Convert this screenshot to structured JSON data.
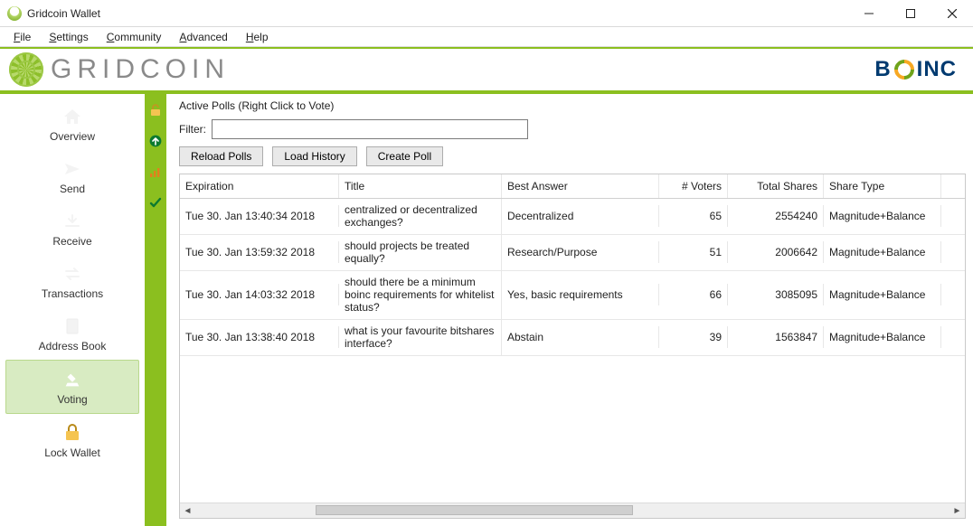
{
  "window": {
    "title": "Gridcoin Wallet"
  },
  "menu": {
    "file": "File",
    "settings": "Settings",
    "community": "Community",
    "advanced": "Advanced",
    "help": "Help"
  },
  "brand": {
    "name": "GRIDCOIN",
    "boinc_b": "B",
    "boinc_inc": "INC"
  },
  "sidebar": {
    "items": [
      {
        "key": "overview",
        "label": "Overview"
      },
      {
        "key": "send",
        "label": "Send"
      },
      {
        "key": "receive",
        "label": "Receive"
      },
      {
        "key": "transactions",
        "label": "Transactions"
      },
      {
        "key": "addressbook",
        "label": "Address Book"
      },
      {
        "key": "voting",
        "label": "Voting"
      },
      {
        "key": "lockwallet",
        "label": "Lock Wallet"
      }
    ],
    "active_key": "voting"
  },
  "statusbar": {
    "lock_icon": "lock-open-icon",
    "sync_icon": "arrow-up-circle-icon",
    "signal_icon": "signal-bars-icon",
    "check_icon": "checkmark-icon"
  },
  "main": {
    "title": "Active Polls (Right Click to Vote)",
    "filter_label": "Filter:",
    "filter_value": "",
    "buttons": {
      "reload": "Reload Polls",
      "history": "Load History",
      "create": "Create Poll"
    },
    "columns": {
      "expiration": "Expiration",
      "title": "Title",
      "best_answer": "Best Answer",
      "voters": "# Voters",
      "shares": "Total Shares",
      "share_type": "Share Type"
    },
    "rows": [
      {
        "expiration": "Tue 30. Jan 13:40:34 2018",
        "title": "centralized or decentralized exchanges?",
        "best_answer": "Decentralized",
        "voters": "65",
        "shares": "2554240",
        "share_type": "Magnitude+Balance"
      },
      {
        "expiration": "Tue 30. Jan 13:59:32 2018",
        "title": "should projects be treated equally?",
        "best_answer": "Research/Purpose",
        "voters": "51",
        "shares": "2006642",
        "share_type": "Magnitude+Balance"
      },
      {
        "expiration": "Tue 30. Jan 14:03:32 2018",
        "title": "should there be a minimum boinc requirements for whitelist status?",
        "best_answer": "Yes, basic  requirements",
        "voters": "66",
        "shares": "3085095",
        "share_type": "Magnitude+Balance"
      },
      {
        "expiration": "Tue 30. Jan 13:38:40 2018",
        "title": "what is your favourite bitshares interface?",
        "best_answer": "Abstain",
        "voters": "39",
        "shares": "1563847",
        "share_type": "Magnitude+Balance"
      }
    ]
  }
}
